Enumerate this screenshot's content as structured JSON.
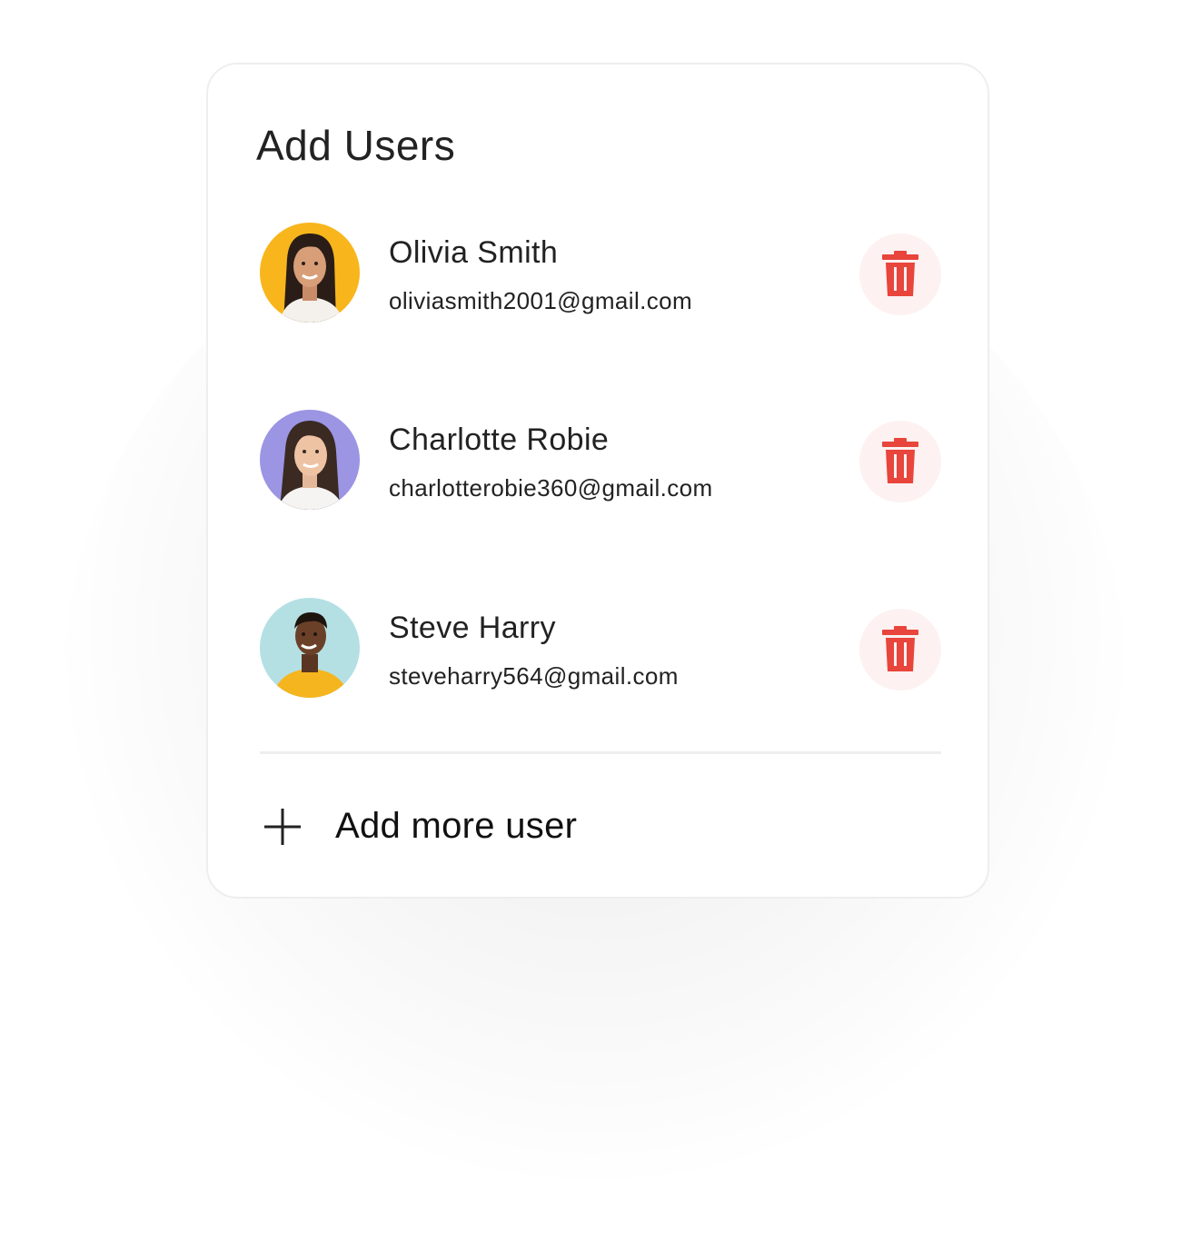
{
  "card": {
    "title": "Add Users"
  },
  "users": [
    {
      "name": "Olivia Smith",
      "email": "oliviasmith2001@gmail.com",
      "avatar_bg": "#f8b61c",
      "delete_icon": "trash-icon"
    },
    {
      "name": "Charlotte Robie",
      "email": "charlotterobie360@gmail.com",
      "avatar_bg": "#9b95e3",
      "delete_icon": "trash-icon"
    },
    {
      "name": "Steve Harry",
      "email": "steveharry564@gmail.com",
      "avatar_bg": "#b4e0e4",
      "delete_icon": "trash-icon"
    }
  ],
  "footer": {
    "add_label": "Add more user",
    "add_icon": "plus-icon"
  },
  "colors": {
    "delete_icon": "#e8453c",
    "delete_bg": "#fdf1f1",
    "divider": "#eeeeee",
    "text": "#222222"
  }
}
